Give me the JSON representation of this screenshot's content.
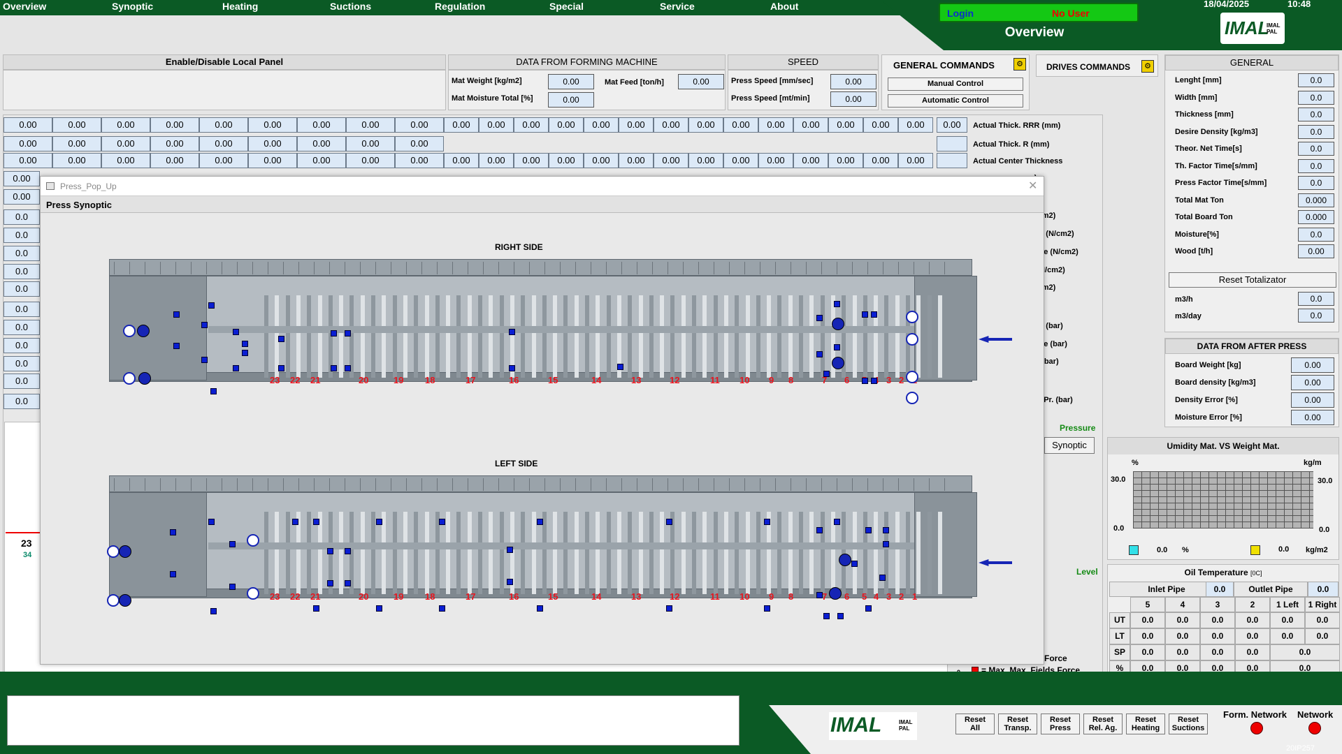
{
  "menu": [
    "Overview",
    "Synoptic",
    "Heating",
    "Suctions",
    "Regulation",
    "Special",
    "Service",
    "About"
  ],
  "header": {
    "date": "18/04/2025",
    "time": "10:48",
    "login_label": "Login",
    "user": "No User",
    "page_title": "Overview",
    "logo": "IMAL",
    "logo_sub": "IMAL PAL"
  },
  "local_panel": {
    "title": "Enable/Disable Local Panel"
  },
  "forming": {
    "title": "DATA FROM FORMING MACHINE",
    "mat_weight_label": "Mat Weight [kg/m2]",
    "mat_weight": "0.00",
    "mat_feed_label": "Mat Feed [ton/h]",
    "mat_feed": "0.00",
    "mat_moisture_label": "Mat Moisture Total [%]",
    "mat_moisture": "0.00"
  },
  "speed": {
    "title": "SPEED",
    "press_speed_mm_label": "Press Speed [mm/sec]",
    "press_speed_mm": "0.00",
    "press_speed_mt_label": "Press Speed [mt/min]",
    "press_speed_mt": "0.00"
  },
  "general_commands": {
    "title": "GENERAL COMMANDS",
    "manual": "Manual Control",
    "automatic": "Automatic Control"
  },
  "drives": {
    "title": "DRIVES COMMANDS"
  },
  "general": {
    "title": "GENERAL",
    "rows": [
      {
        "label": "Lenght [mm]",
        "value": "0.0"
      },
      {
        "label": "Width [mm]",
        "value": "0.0"
      },
      {
        "label": "Thickness [mm]",
        "value": "0.0"
      },
      {
        "label": "Desire Density [kg/m3]",
        "value": "0.0"
      },
      {
        "label": "Theor. Net Time[s]",
        "value": "0.0"
      },
      {
        "label": "Th. Factor Time[s/mm]",
        "value": "0.0"
      },
      {
        "label": "Press Factor Time[s/mm]",
        "value": "0.0"
      },
      {
        "label": "Total Mat Ton",
        "value": "0.000"
      },
      {
        "label": "Total Board Ton",
        "value": "0.000"
      },
      {
        "label": "Moisture[%]",
        "value": "0.0"
      },
      {
        "label": "Wood [t/h]",
        "value": "0.00"
      }
    ],
    "reset": "Reset Totalizator",
    "m3h_label": "m3/h",
    "m3h": "0.0",
    "m3day_label": "m3/day",
    "m3day": "0.0"
  },
  "after_press": {
    "title": "DATA FROM AFTER PRESS",
    "rows": [
      {
        "label": "Board Weight [kg]",
        "value": "0.00"
      },
      {
        "label": "Board density [kg/m3]",
        "value": "0.00"
      },
      {
        "label": "Density Error [%]",
        "value": "0.00"
      },
      {
        "label": "Moisture Error [%]",
        "value": "0.00"
      }
    ]
  },
  "thickness_rows": {
    "values_row": "0.00",
    "labels": [
      "Actual Thick. RRR (mm)",
      "Actual Thick. R (mm)",
      "Actual Center Thickness",
      "m)",
      "mm)",
      "(N/cm2)",
      "sure (N/cm2)",
      "ssure (N/cm2)",
      "re (N/cm2)",
      "(N/cm2)",
      "(bar)",
      "sure (bar)",
      "ssure (bar)",
      "ure (bar)",
      "(bar)",
      "ting Pr. (bar)"
    ]
  },
  "left_partial": {
    "values": [
      "0.00",
      "0.00",
      "0.0",
      "0.0",
      "0.0",
      "0.0",
      "0.0",
      "0.0",
      "0.0",
      "0.0",
      "0.0",
      "0.0",
      "0.0"
    ]
  },
  "trend": {
    "value1": "23",
    "value2": "34"
  },
  "pressure_label": "Pressure",
  "synoptic_btn": "Synoptic",
  "level_label": "Level",
  "force_label": "Force",
  "max_force_label": "Max. Max. Fields Force",
  "zero_label": "0",
  "humidity": {
    "title": "Umidity Mat. VS Weight Mat.",
    "y_left_unit": "%",
    "y_right_unit": "kg/m",
    "left_max": "30.0",
    "left_min": "0.0",
    "right_max": "30.0",
    "right_min": "0.0",
    "legend1_value": "0.0",
    "legend1_unit": "%",
    "legend2_value": "0.0",
    "legend2_unit": "kg/m2",
    "color1": "#33e0e8",
    "color2": "#f0e000"
  },
  "oil": {
    "title": "Oil Temperature",
    "unit": "[0C]",
    "inlet_label": "Inlet Pipe",
    "inlet": "0.0",
    "outlet_label": "Outlet Pipe",
    "outlet": "0.0",
    "cols": [
      "5",
      "4",
      "3",
      "2",
      "1 Left",
      "1 Right"
    ],
    "rows": [
      {
        "label": "UT",
        "values": [
          "0.0",
          "0.0",
          "0.0",
          "0.0",
          "0.0",
          "0.0"
        ]
      },
      {
        "label": "LT",
        "values": [
          "0.0",
          "0.0",
          "0.0",
          "0.0",
          "0.0",
          "0.0"
        ]
      },
      {
        "label": "SP",
        "values": [
          "0.0",
          "0.0",
          "0.0",
          "0.0",
          "0.0"
        ]
      },
      {
        "label": "%",
        "values": [
          "0.0",
          "0.0",
          "0.0",
          "0.0",
          "0.0"
        ]
      }
    ]
  },
  "popup": {
    "window_title": "Press_Pop_Up",
    "title": "Press Synoptic",
    "right_side": "RIGHT SIDE",
    "left_side": "LEFT SIDE",
    "zones": [
      "23",
      "22",
      "21",
      "20",
      "19",
      "18",
      "17",
      "16",
      "15",
      "14",
      "13",
      "12",
      "11",
      "10",
      "9",
      "8",
      "7",
      "6",
      "5",
      "4",
      "3",
      "2",
      "1"
    ]
  },
  "bottom": {
    "buttons": [
      {
        "l1": "Reset",
        "l2": "All"
      },
      {
        "l1": "Reset",
        "l2": "Transp."
      },
      {
        "l1": "Reset",
        "l2": "Press"
      },
      {
        "l1": "Reset",
        "l2": "Rel. Ag."
      },
      {
        "l1": "Reset",
        "l2": "Heating"
      },
      {
        "l1": "Reset",
        "l2": "Suctions"
      }
    ],
    "form_network": "Form. Network",
    "network": "Network",
    "code": "20IP257",
    "logo": "IMAL",
    "logo_sub": "IMAL PAL"
  }
}
